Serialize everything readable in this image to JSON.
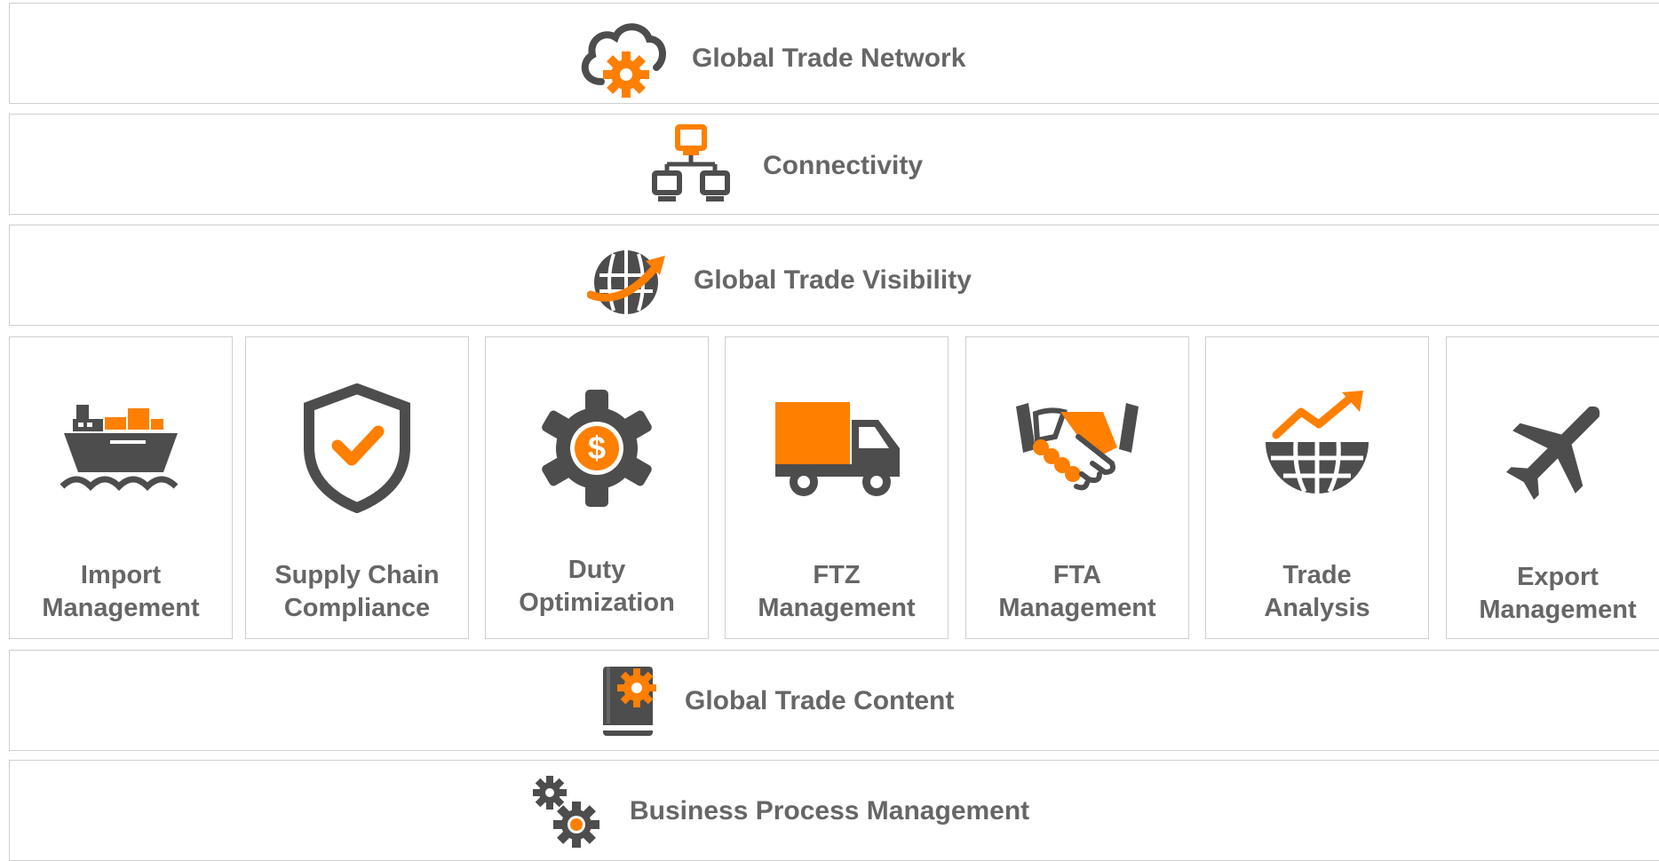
{
  "colors": {
    "accent": "#FF7F00",
    "icon_dark": "#4D4D4D",
    "text": "#666666",
    "border": "#CFCFCF"
  },
  "bands": {
    "network": {
      "label": "Global Trade Network",
      "icon": "cloud-gear-icon"
    },
    "connectivity": {
      "label": "Connectivity",
      "icon": "network-computers-icon"
    },
    "visibility": {
      "label": "Global Trade Visibility",
      "icon": "globe-arrow-icon"
    },
    "content": {
      "label": "Global Trade Content",
      "icon": "book-gear-icon"
    },
    "bpm": {
      "label": "Business Process Management",
      "icon": "gears-icon"
    }
  },
  "modules": [
    {
      "line1": "Import",
      "line2": "Management",
      "icon": "cargo-ship-icon"
    },
    {
      "line1": "Supply Chain",
      "line2": "Compliance",
      "icon": "shield-check-icon"
    },
    {
      "line1": "Duty",
      "line2": "Optimization",
      "icon": "gear-dollar-icon"
    },
    {
      "line1": "FTZ",
      "line2": "Management",
      "icon": "truck-icon"
    },
    {
      "line1": "FTA",
      "line2": "Management",
      "icon": "handshake-icon"
    },
    {
      "line1": "Trade",
      "line2": "Analysis",
      "icon": "globe-trend-icon"
    },
    {
      "line1": "Export",
      "line2": "Management",
      "icon": "airplane-icon"
    }
  ]
}
